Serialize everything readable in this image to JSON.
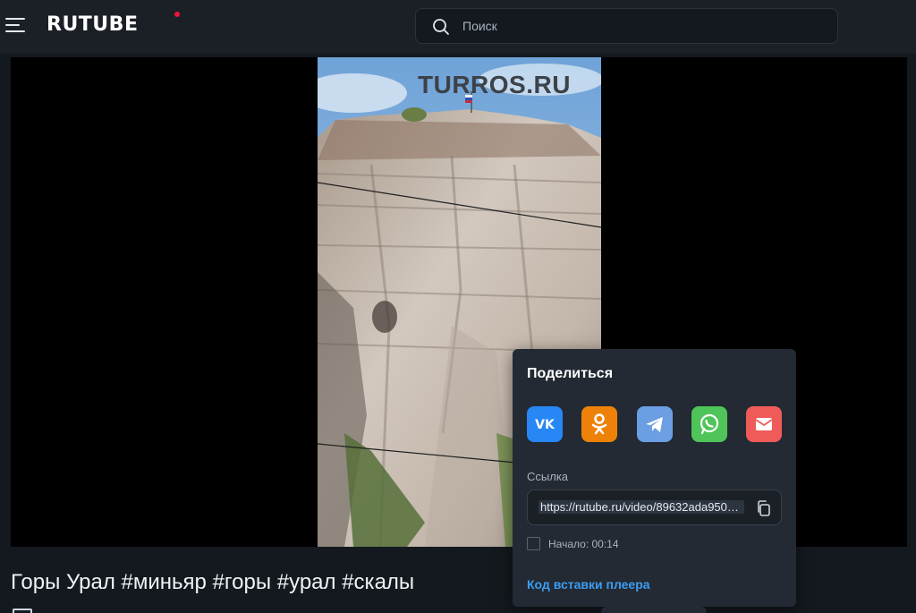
{
  "header": {
    "logo": "RUTUBE",
    "search_placeholder": "Поиск"
  },
  "player": {
    "watermark": "TURROS.RU"
  },
  "video": {
    "title": "Горы Урал #миньяр #горы #урал #скалы"
  },
  "share": {
    "title": "Поделиться",
    "social": [
      {
        "name": "vk-share-icon",
        "color": "#2787f5"
      },
      {
        "name": "ok-share-icon",
        "color": "#ee8208"
      },
      {
        "name": "telegram-share-icon",
        "color": "#6b9ee2"
      },
      {
        "name": "whatsapp-share-icon",
        "color": "#4fc459"
      },
      {
        "name": "email-share-icon",
        "color": "#ef5b59"
      }
    ],
    "link_label": "Ссылка",
    "link_value": "https://rutube.ru/video/89632ada9506...",
    "start_label": "Начало: 00:14",
    "embed_label": "Код вставки плеера"
  },
  "colors": {
    "background": "#14191f",
    "header": "#1b2027",
    "panel": "#232a33",
    "accent_link": "#3d9df2",
    "logo_dot": "#ed143b"
  }
}
